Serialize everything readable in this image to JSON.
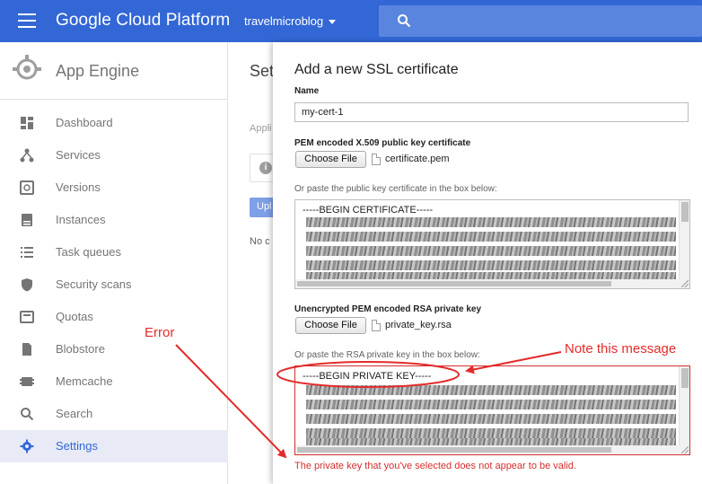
{
  "topbar": {
    "brand": "Google Cloud Platform",
    "project": "travelmicroblog",
    "bg_color": "#3367d6"
  },
  "sidebar": {
    "app_title": "App Engine",
    "items": [
      {
        "label": "Dashboard",
        "icon": "dashboard-icon"
      },
      {
        "label": "Services",
        "icon": "services-icon"
      },
      {
        "label": "Versions",
        "icon": "versions-icon"
      },
      {
        "label": "Instances",
        "icon": "instances-icon"
      },
      {
        "label": "Task queues",
        "icon": "task-queues-icon"
      },
      {
        "label": "Security scans",
        "icon": "shield-icon"
      },
      {
        "label": "Quotas",
        "icon": "quotas-icon"
      },
      {
        "label": "Blobstore",
        "icon": "blobstore-icon"
      },
      {
        "label": "Memcache",
        "icon": "memcache-icon"
      },
      {
        "label": "Search",
        "icon": "search-icon"
      },
      {
        "label": "Settings",
        "icon": "gear-icon",
        "active": true
      }
    ]
  },
  "background": {
    "title_fragment": "Set",
    "sub_fragment": "Appli",
    "button_fragment": "Upl",
    "empty_fragment": "No c"
  },
  "dialog": {
    "title": "Add a new SSL certificate",
    "name_label": "Name",
    "name_value": "my-cert-1",
    "cert_label": "PEM encoded X.509 public key certificate",
    "cert_button": "Choose File",
    "cert_file": "certificate.pem",
    "cert_paste_label": "Or paste the public key certificate in the box below:",
    "cert_first_line": "-----BEGIN CERTIFICATE-----",
    "key_label": "Unencrypted PEM encoded RSA private key",
    "key_button": "Choose File",
    "key_file": "private_key.rsa",
    "key_paste_label": "Or paste the RSA private key in the box below:",
    "key_first_line": "-----BEGIN PRIVATE KEY-----",
    "error_message": "The private key that you've selected does not appear to be valid.",
    "error_color": "#d32f2f"
  },
  "annotations": {
    "error_label": "Error",
    "note_label": "Note this message",
    "color": "#e32b2b"
  }
}
